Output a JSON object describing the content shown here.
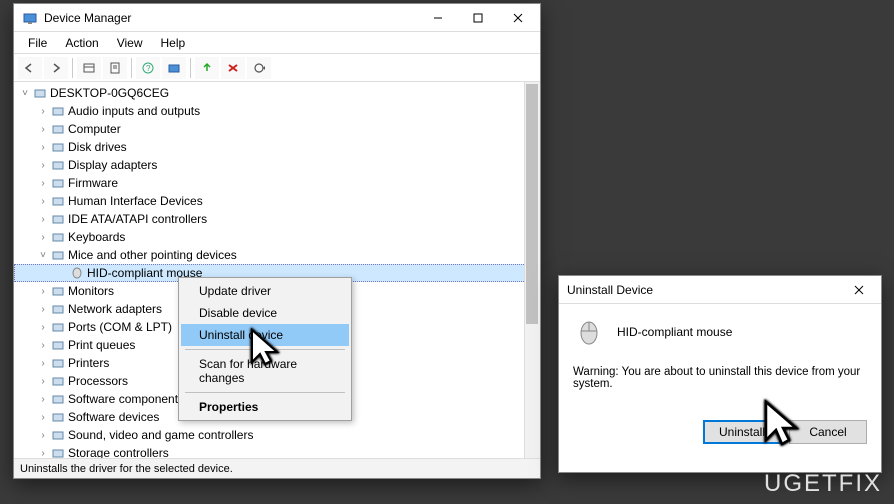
{
  "window": {
    "title": "Device Manager",
    "menus": [
      "File",
      "Action",
      "View",
      "Help"
    ],
    "statusbar": "Uninstalls the driver for the selected device.",
    "root_label": "DESKTOP-0GQ6CEG",
    "categories": [
      {
        "label": "Audio inputs and outputs",
        "expanded": false
      },
      {
        "label": "Computer",
        "expanded": false
      },
      {
        "label": "Disk drives",
        "expanded": false
      },
      {
        "label": "Display adapters",
        "expanded": false
      },
      {
        "label": "Firmware",
        "expanded": false
      },
      {
        "label": "Human Interface Devices",
        "expanded": false
      },
      {
        "label": "IDE ATA/ATAPI controllers",
        "expanded": false
      },
      {
        "label": "Keyboards",
        "expanded": false
      },
      {
        "label": "Mice and other pointing devices",
        "expanded": true,
        "children": [
          {
            "label": "HID-compliant mouse",
            "selected": true
          }
        ]
      },
      {
        "label": "Monitors",
        "expanded": false
      },
      {
        "label": "Network adapters",
        "expanded": false
      },
      {
        "label": "Ports (COM & LPT)",
        "expanded": false
      },
      {
        "label": "Print queues",
        "expanded": false
      },
      {
        "label": "Printers",
        "expanded": false
      },
      {
        "label": "Processors",
        "expanded": false
      },
      {
        "label": "Software components",
        "expanded": false
      },
      {
        "label": "Software devices",
        "expanded": false
      },
      {
        "label": "Sound, video and game controllers",
        "expanded": false
      },
      {
        "label": "Storage controllers",
        "expanded": false
      }
    ]
  },
  "context_menu": {
    "items": [
      {
        "label": "Update driver",
        "highlight": false
      },
      {
        "label": "Disable device",
        "highlight": false
      },
      {
        "label": "Uninstall device",
        "highlight": true
      },
      {
        "sep": true
      },
      {
        "label": "Scan for hardware changes",
        "highlight": false
      },
      {
        "sep": true
      },
      {
        "label": "Properties",
        "highlight": false,
        "bold": true
      }
    ]
  },
  "dialog": {
    "title": "Uninstall Device",
    "device": "HID-compliant mouse",
    "warning": "Warning: You are about to uninstall this device from your system.",
    "ok": "Uninstall",
    "cancel": "Cancel"
  },
  "watermark": "UGETFIX"
}
